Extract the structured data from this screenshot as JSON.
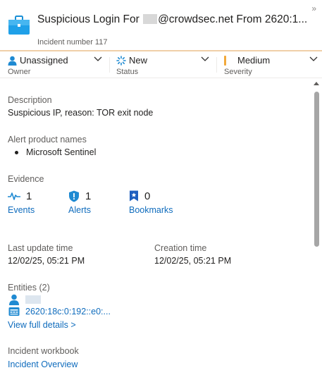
{
  "header": {
    "title_prefix": "Suspicious Login For",
    "title_suffix": "@crowdsec.net From 2620:1...",
    "incident_number": "Incident number 117",
    "expand_icon": "chevron-double-right-icon",
    "accent_color": "#f0cfa8"
  },
  "status_bar": {
    "owner": {
      "value": "Unassigned",
      "label": "Owner",
      "icon": "person-icon"
    },
    "status": {
      "value": "New",
      "label": "Status",
      "icon": "spinner-icon"
    },
    "severity": {
      "value": "Medium",
      "label": "Severity",
      "color": "#f2a93b"
    }
  },
  "description": {
    "label": "Description",
    "value": "Suspicious IP, reason: TOR exit node"
  },
  "alert_products": {
    "label": "Alert product names",
    "items": [
      "Microsoft Sentinel"
    ]
  },
  "evidence": {
    "label": "Evidence",
    "events": {
      "count": "1",
      "name": "Events"
    },
    "alerts": {
      "count": "1",
      "name": "Alerts"
    },
    "bookmarks": {
      "count": "0",
      "name": "Bookmarks"
    }
  },
  "times": {
    "last_update_label": "Last update time",
    "last_update_value": "12/02/25, 05:21 PM",
    "creation_label": "Creation time",
    "creation_value": "12/02/25, 05:21 PM"
  },
  "entities": {
    "label": "Entities (2)",
    "ip": "2620:18c:0:192::e0:...",
    "view_full": "View full details >"
  },
  "workbook": {
    "label": "Incident workbook",
    "link": "Incident Overview"
  }
}
